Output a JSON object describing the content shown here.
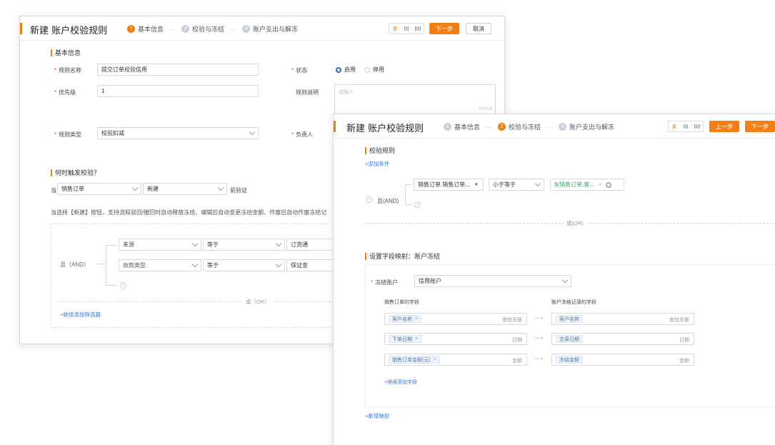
{
  "panel1": {
    "title": "新建 账户校验规则",
    "steps": [
      {
        "num": "1",
        "label": "基本信息"
      },
      {
        "num": "2",
        "label": "校验与冻结"
      },
      {
        "num": "3",
        "label": "账户支出与解冻"
      }
    ],
    "step_sep": "···",
    "layout_icons": [
      "II",
      "III",
      "IIII"
    ],
    "next_label": "下一步",
    "cancel_label": "取消",
    "basic_section": "基本信息",
    "rule_name_label": "规则名称",
    "rule_name_value": "提交订单校验信用",
    "status_label": "状态",
    "status_enabled": "启用",
    "status_disabled": "停用",
    "priority_label": "优先级",
    "priority_value": "1",
    "desc_label": "规则说明",
    "desc_placeholder": "请输入",
    "desc_count": "0/1000",
    "type_label": "规则类型",
    "type_value": "校验扣减",
    "owner_label": "负责人",
    "trigger_section": "何时触发校验？",
    "when_label": "当",
    "when_object": "销售订单",
    "when_action": "新建",
    "when_suffix": "前验证",
    "trigger_desc": "当选择【新建】按钮，支持流程驳回/撤回时自动释放冻结、编辑后自动变更冻结金额、作废后自动作废冻结记",
    "and_label": "且（AND）",
    "conditions": [
      {
        "field": "来源",
        "op": "等于",
        "value": "订货通"
      },
      {
        "field": "收款类型",
        "op": "等于",
        "value": "保证金"
      }
    ],
    "or_label": "或（OR）",
    "add_filter": "+继续添加筛选器"
  },
  "panel2": {
    "title": "新建 账户校验规则",
    "steps": [
      {
        "num": "1",
        "label": "基本信息"
      },
      {
        "num": "2",
        "label": "校验与冻结"
      },
      {
        "num": "3",
        "label": "账户支出与解冻"
      }
    ],
    "step_sep": "···",
    "layout_icons": [
      "II",
      "III",
      "IIII"
    ],
    "prev_label": "上一步",
    "next_label": "下一步",
    "check_section": "校验规则",
    "add_condition": "+添加条件",
    "and_label": "且(AND)",
    "cond_field": "销售订单.销售订单...",
    "cond_op": "小于等于",
    "cond_value": "$(销售订单.客...",
    "cond_value_x": "×",
    "or_label": "或(OR)",
    "mapping_section": "设置字段映射：账户冻结",
    "freeze_account_label": "冻结账户",
    "freeze_account_value": "信用账户",
    "col_left": "销售订单的字段",
    "col_right": "账户冻结记录的字段",
    "mappings": [
      {
        "left": "客户名称",
        "left_suffix": "查找关联",
        "right": "客户名称",
        "right_suffix": "查找关联"
      },
      {
        "left": "下单日期",
        "left_suffix": "日期",
        "right": "交易日期",
        "right_suffix": "日期"
      },
      {
        "left": "销售订单金额(元)",
        "left_suffix": "金额",
        "right": "冻结金额",
        "right_suffix": "金额"
      }
    ],
    "arrow": "⟶",
    "add_field": "+继续添加字段",
    "add_mapping": "+新增映射"
  }
}
